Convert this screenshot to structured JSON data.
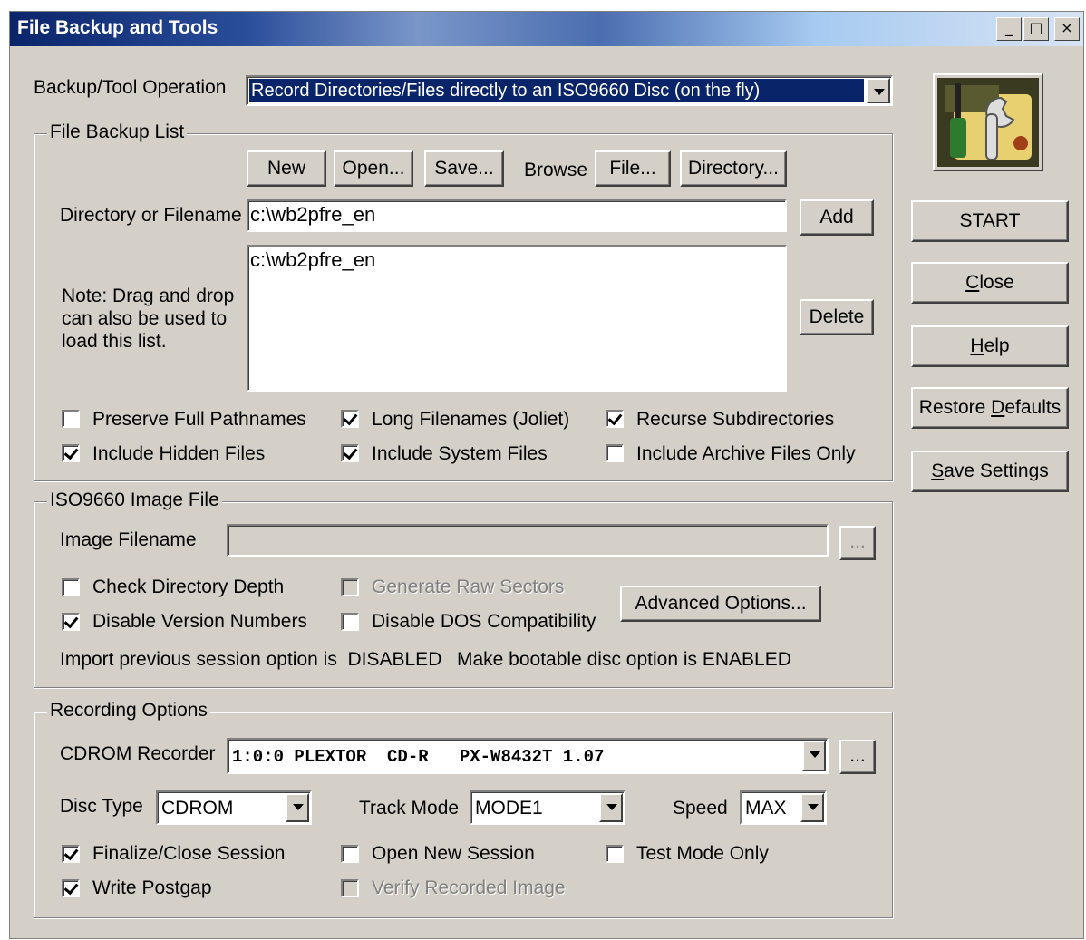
{
  "window": {
    "title": "File Backup and Tools",
    "min": "_",
    "max": "□",
    "close": "×"
  },
  "operation": {
    "label": "Backup/Tool Operation",
    "value": "Record Directories/Files directly to an ISO9660 Disc (on the fly)"
  },
  "backup_list": {
    "legend": "File Backup List",
    "new": "New",
    "open": "Open...",
    "save": "Save...",
    "browse": "Browse",
    "file": "File...",
    "directory": "Directory...",
    "dir_label": "Directory or Filename",
    "dir_value": "c:\\wb2pfre_en",
    "add": "Add",
    "note": "Note: Drag and drop can also be used to load this list.",
    "list_items": [
      "c:\\wb2pfre_en"
    ],
    "delete": "Delete",
    "preserve": "Preserve Full Pathnames",
    "long": "Long Filenames (Joliet)",
    "recurse": "Recurse Subdirectories",
    "hidden": "Include Hidden Files",
    "system": "Include System Files",
    "archive": "Include Archive Files Only"
  },
  "iso": {
    "legend": "ISO9660 Image File",
    "image_label": "Image Filename",
    "image_value": "",
    "browse_btn": "...",
    "check_depth": "Check Directory Depth",
    "raw_sectors": "Generate Raw Sectors",
    "advanced": "Advanced Options...",
    "disable_version": "Disable Version Numbers",
    "disable_dos": "Disable DOS Compatibility",
    "import_status": "Import previous session option is  DISABLED",
    "bootable_status": "Make bootable disc option is ENABLED"
  },
  "recording": {
    "legend": "Recording Options",
    "recorder_label": "CDROM Recorder",
    "recorder_value": "1:0:0 PLEXTOR  CD-R   PX-W8432T 1.07",
    "recorder_btn": "...",
    "disc_type_label": "Disc Type",
    "disc_type_value": "CDROM",
    "track_mode_label": "Track Mode",
    "track_mode_value": "MODE1",
    "speed_label": "Speed",
    "speed_value": "MAX",
    "finalize": "Finalize/Close Session",
    "open_new": "Open New Session",
    "test_mode": "Test Mode Only",
    "postgap": "Write Postgap",
    "verify": "Verify Recorded Image"
  },
  "side": {
    "start": "START",
    "close_u": "C",
    "close_rest": "lose",
    "help_u": "H",
    "help_rest": "elp",
    "restore_pre": "Restore ",
    "restore_u": "D",
    "restore_rest": "efaults",
    "save_u": "S",
    "save_rest": "ave Settings"
  },
  "icons": {
    "app": "tools-icon"
  }
}
